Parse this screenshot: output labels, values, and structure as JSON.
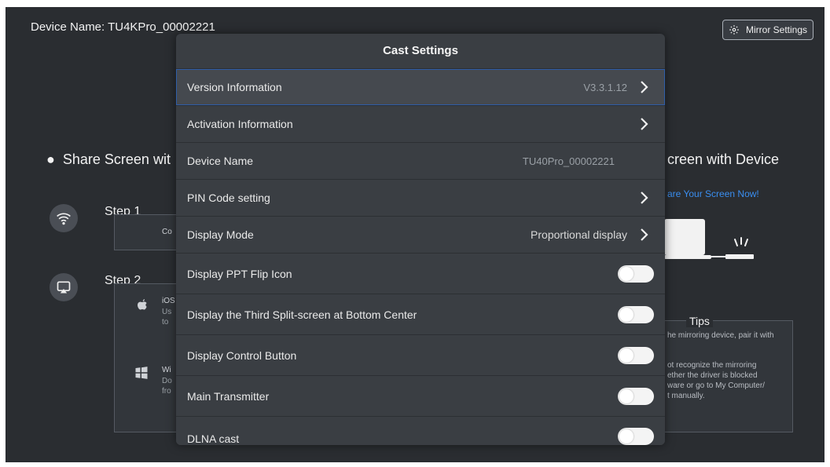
{
  "header": {
    "device_name": "Device Name: TU4KPro_00002221",
    "mirror_button": "Mirror Settings"
  },
  "background": {
    "share_left": "Share Screen wit",
    "share_right": "creen with Device",
    "share_link": "are Your Screen Now!",
    "step1": "Step  1",
    "step2": "Step  2",
    "step1_text": "Co",
    "ios_short": "iOS",
    "ios_line1": "Us",
    "ios_line2": "to",
    "win_short": "Wi",
    "win_line1": "Do",
    "win_line2": "fro",
    "tips_title": "Tips",
    "tips_lines": [
      "he mirroring device, pair it with",
      "ot recognize the mirroring",
      "ether the driver is blocked",
      "ware or go to My Computer/",
      "t manually."
    ]
  },
  "modal": {
    "title": "Cast Settings",
    "rows": [
      {
        "label": "Version Information",
        "value": "V3.3.1.12"
      },
      {
        "label": "Activation Information"
      },
      {
        "label": "Device Name",
        "value": "TU40Pro_00002221"
      },
      {
        "label": "PIN Code setting"
      },
      {
        "label": "Display Mode",
        "value": "Proportional display"
      },
      {
        "label": "Display PPT Flip Icon"
      },
      {
        "label": "Display the Third Split-screen at Bottom Center"
      },
      {
        "label": "Display Control Button"
      },
      {
        "label": "Main Transmitter"
      },
      {
        "label": "DLNA cast"
      }
    ]
  },
  "icons": {
    "mirror_settings": "gear-icon",
    "step1": "wifi-icon",
    "step2": "screen-cast-icon",
    "ios": "apple-icon",
    "windows": "windows-icon",
    "chevron": "chevron-right-icon"
  }
}
